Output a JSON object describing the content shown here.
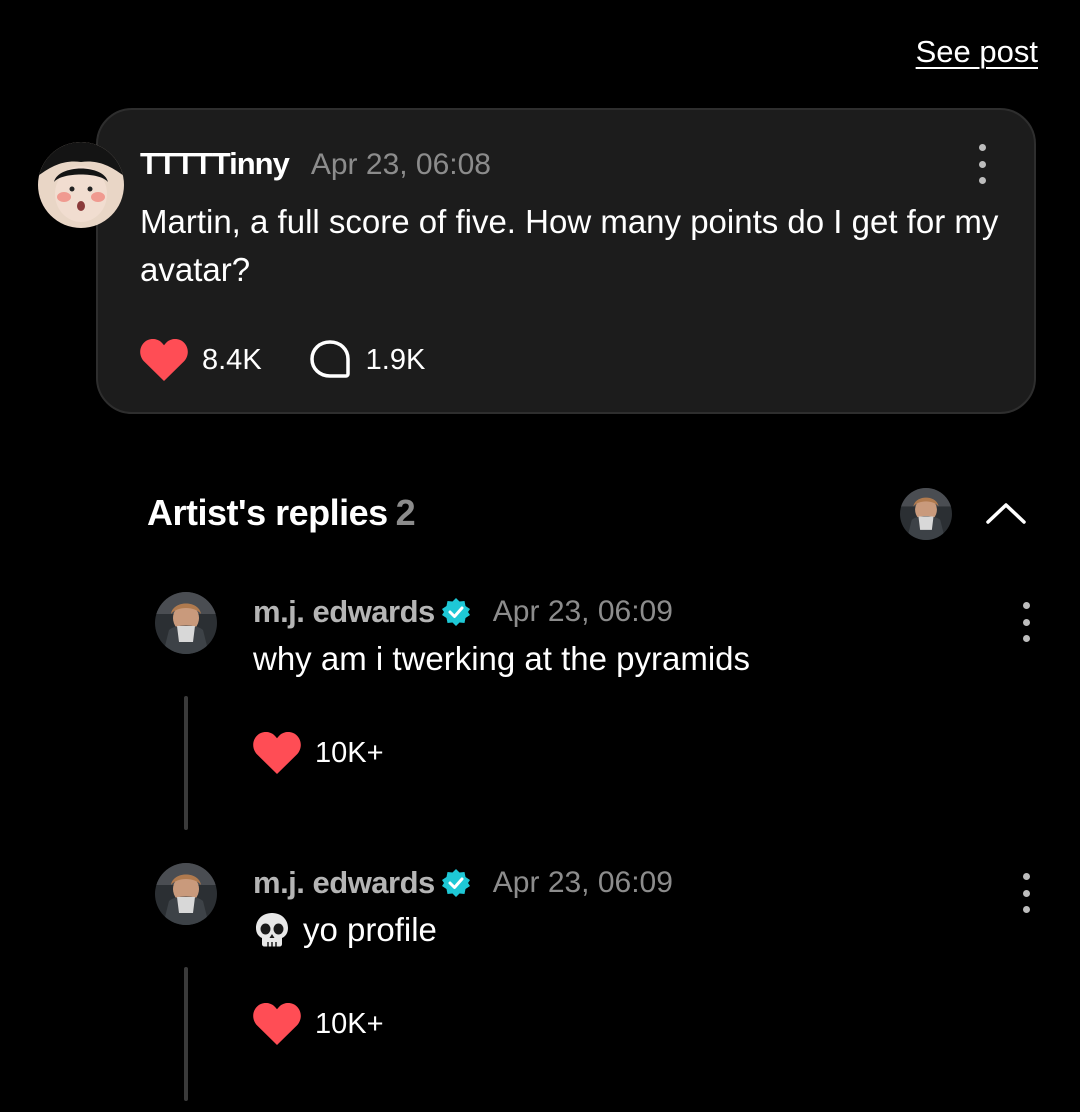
{
  "header": {
    "see_post_label": "See post"
  },
  "post": {
    "author": "TTTTTinny",
    "timestamp": "Apr 23, 06:08",
    "text": "Martin, a full score of five. How many points do I get for my avatar?",
    "likes": "8.4K",
    "comments": "1.9K",
    "icons": {
      "like": "heart-icon",
      "comment": "speech-bubble-icon",
      "more": "more-vertical-icon"
    }
  },
  "replies_section": {
    "title": "Artist's replies",
    "count": "2",
    "collapse_icon": "chevron-up-icon"
  },
  "replies": [
    {
      "author": "m.j. edwards",
      "verified": true,
      "timestamp": "Apr 23, 06:09",
      "text": "why am i twerking at the pyramids",
      "emoji": "",
      "likes": "10K+"
    },
    {
      "author": "m.j. edwards",
      "verified": true,
      "timestamp": "Apr 23, 06:09",
      "text": "yo profile",
      "emoji": "skull-icon",
      "likes": "10K+"
    }
  ],
  "colors": {
    "background": "#000000",
    "card": "#1c1c1c",
    "like_red": "#ff4d55",
    "verified_teal": "#1ec8d6",
    "muted_text": "#8c8c8c"
  }
}
